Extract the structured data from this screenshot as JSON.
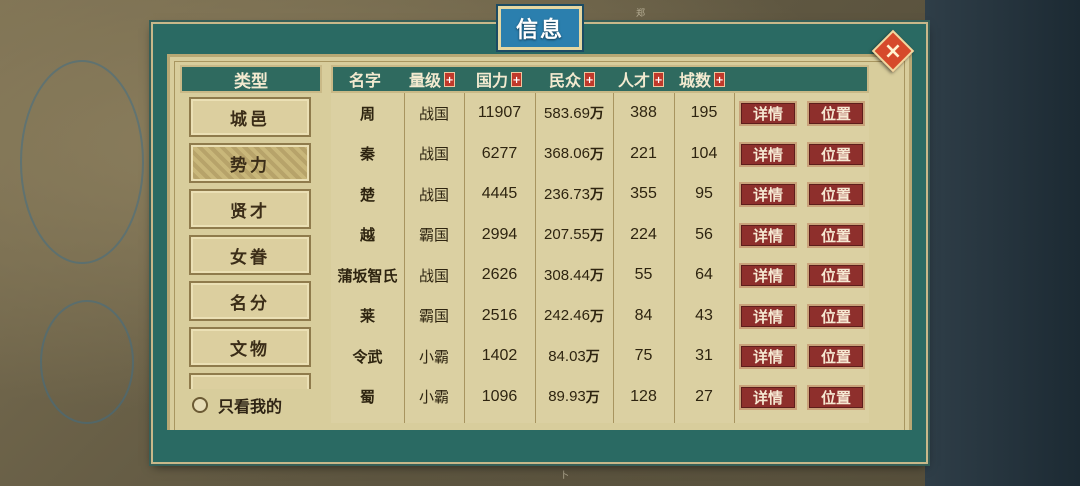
{
  "title": "信息",
  "close_label": "×",
  "categories": {
    "header": "类型",
    "items": [
      "城邑",
      "势力",
      "贤才",
      "女眷",
      "名分",
      "文物"
    ],
    "active_index": 1
  },
  "only_mine_label": "只看我的",
  "columns": [
    {
      "label": "名字",
      "sortable": false
    },
    {
      "label": "量级",
      "sortable": true
    },
    {
      "label": "国力",
      "sortable": true
    },
    {
      "label": "民众",
      "sortable": true
    },
    {
      "label": "人才",
      "sortable": true
    },
    {
      "label": "城数",
      "sortable": true
    }
  ],
  "sort_icon": "+",
  "rows": [
    {
      "name": "周",
      "tier": "战国",
      "power": "11907",
      "pop": "583.69",
      "talent": "388",
      "cities": "195"
    },
    {
      "name": "秦",
      "tier": "战国",
      "power": "6277",
      "pop": "368.06",
      "talent": "221",
      "cities": "104"
    },
    {
      "name": "楚",
      "tier": "战国",
      "power": "4445",
      "pop": "236.73",
      "talent": "355",
      "cities": "95"
    },
    {
      "name": "越",
      "tier": "霸国",
      "power": "2994",
      "pop": "207.55",
      "talent": "224",
      "cities": "56"
    },
    {
      "name": "蒲坂智氏",
      "tier": "战国",
      "power": "2626",
      "pop": "308.44",
      "talent": "55",
      "cities": "64"
    },
    {
      "name": "莱",
      "tier": "霸国",
      "power": "2516",
      "pop": "242.46",
      "talent": "84",
      "cities": "43"
    },
    {
      "name": "令武",
      "tier": "小霸",
      "power": "1402",
      "pop": "84.03",
      "talent": "75",
      "cities": "31"
    },
    {
      "name": "蜀",
      "tier": "小霸",
      "power": "1096",
      "pop": "89.93",
      "talent": "128",
      "cities": "27"
    }
  ],
  "pop_unit": "万",
  "detail_label": "详情",
  "location_label": "位置",
  "map_labels": [
    "郑",
    "卜"
  ]
}
